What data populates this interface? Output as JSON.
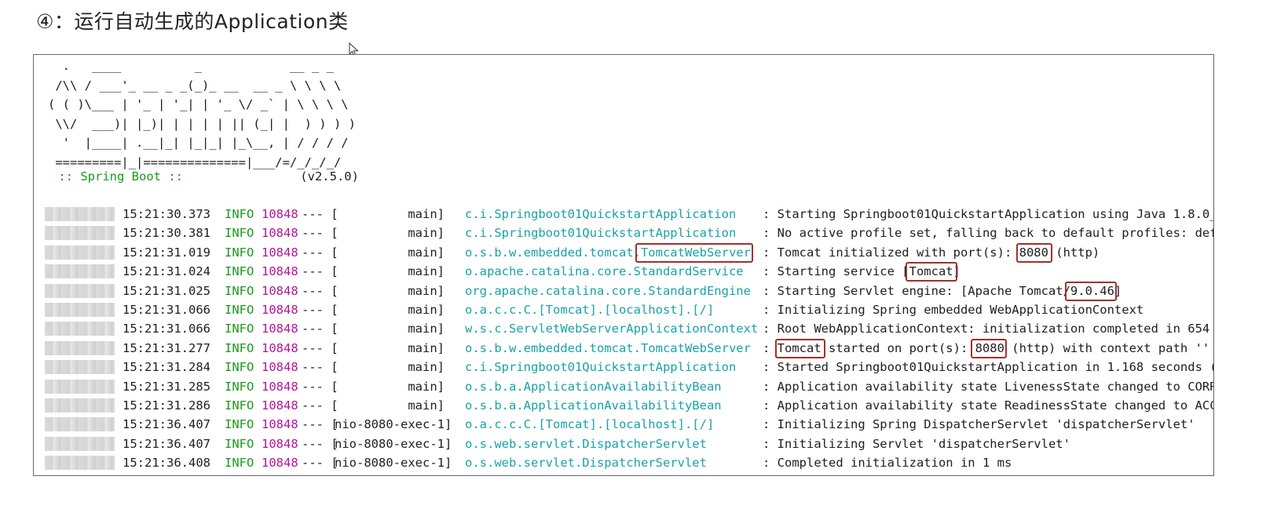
{
  "heading": "④：运行自动生成的Application类",
  "banner_art": [
    "  .   ____          _            __ _ _",
    " /\\\\ / ___'_ __ _ _(_)_ __  __ _ \\ \\ \\ \\",
    "( ( )\\___ | '_ | '_| | '_ \\/ _` | \\ \\ \\ \\",
    " \\\\/  ___)| |_)| | | | | || (_| |  ) ) ) )",
    "  '  |____| .__|_| |_|_| |_\\__, | / / / /",
    " =========|_|==============|___/=/_/_/_/"
  ],
  "spring_label": " :: Spring Boot :: ",
  "spring_version": "               (v2.5.0)",
  "log_rows": [
    {
      "time": "15:21:30.373",
      "level": "INFO",
      "pid": "10848",
      "sep": "--- [",
      "thread": "          main]",
      "logger": "c.i.Springboot01QuickstartApplication",
      "msg": ": Starting Springboot01QuickstartApplication using Java 1.8.0_"
    },
    {
      "time": "15:21:30.381",
      "level": "INFO",
      "pid": "10848",
      "sep": "--- [",
      "thread": "          main]",
      "logger": "c.i.Springboot01QuickstartApplication",
      "msg": ": No active profile set, falling back to default profiles: def"
    },
    {
      "time": "15:21:31.019",
      "level": "INFO",
      "pid": "10848",
      "sep": "--- [",
      "thread": "          main]",
      "logger": "o.s.b.w.embedded.tomcat.TomcatWebServer",
      "msg": ": Tomcat initialized with port(s): 8080 (http)"
    },
    {
      "time": "15:21:31.024",
      "level": "INFO",
      "pid": "10848",
      "sep": "--- [",
      "thread": "          main]",
      "logger": "o.apache.catalina.core.StandardService",
      "msg": ": Starting service [Tomcat]"
    },
    {
      "time": "15:21:31.025",
      "level": "INFO",
      "pid": "10848",
      "sep": "--- [",
      "thread": "          main]",
      "logger": "org.apache.catalina.core.StandardEngine",
      "msg": ": Starting Servlet engine: [Apache Tomcat/9.0.46]"
    },
    {
      "time": "15:21:31.066",
      "level": "INFO",
      "pid": "10848",
      "sep": "--- [",
      "thread": "          main]",
      "logger": "o.a.c.c.C.[Tomcat].[localhost].[/]",
      "msg": ": Initializing Spring embedded WebApplicationContext"
    },
    {
      "time": "15:21:31.066",
      "level": "INFO",
      "pid": "10848",
      "sep": "--- [",
      "thread": "          main]",
      "logger": "w.s.c.ServletWebServerApplicationContext",
      "msg": ": Root WebApplicationContext: initialization completed in 654"
    },
    {
      "time": "15:21:31.277",
      "level": "INFO",
      "pid": "10848",
      "sep": "--- [",
      "thread": "          main]",
      "logger": "o.s.b.w.embedded.tomcat.TomcatWebServer",
      "msg": ": Tomcat started on port(s): 8080 (http) with context path ''"
    },
    {
      "time": "15:21:31.284",
      "level": "INFO",
      "pid": "10848",
      "sep": "--- [",
      "thread": "          main]",
      "logger": "c.i.Springboot01QuickstartApplication",
      "msg": ": Started Springboot01QuickstartApplication in 1.168 seconds ("
    },
    {
      "time": "15:21:31.285",
      "level": "INFO",
      "pid": "10848",
      "sep": "--- [",
      "thread": "          main]",
      "logger": "o.s.b.a.ApplicationAvailabilityBean",
      "msg": ": Application availability state LivenessState changed to CORR"
    },
    {
      "time": "15:21:31.286",
      "level": "INFO",
      "pid": "10848",
      "sep": "--- [",
      "thread": "          main]",
      "logger": "o.s.b.a.ApplicationAvailabilityBean",
      "msg": ": Application availability state ReadinessState changed to ACC"
    },
    {
      "time": "15:21:36.407",
      "level": "INFO",
      "pid": "10848",
      "sep": "--- [",
      "thread": "nio-8080-exec-1]",
      "logger": "o.a.c.c.C.[Tomcat].[localhost].[/]",
      "msg": ": Initializing Spring DispatcherServlet 'dispatcherServlet'"
    },
    {
      "time": "15:21:36.407",
      "level": "INFO",
      "pid": "10848",
      "sep": "--- [",
      "thread": "nio-8080-exec-1]",
      "logger": "o.s.web.servlet.DispatcherServlet",
      "msg": ": Initializing Servlet 'dispatcherServlet'"
    },
    {
      "time": "15:21:36.408",
      "level": "INFO",
      "pid": "10848",
      "sep": "--- [",
      "thread": "nio-8080-exec-1]",
      "logger": "o.s.web.servlet.DispatcherServlet",
      "msg": ": Completed initialization in 1 ms"
    }
  ],
  "highlight_color": "#a3302c",
  "colors": {
    "info": "#1a9a1a",
    "pid": "#b3159a",
    "logger": "#18a3a8",
    "text": "#1e1e1e"
  }
}
